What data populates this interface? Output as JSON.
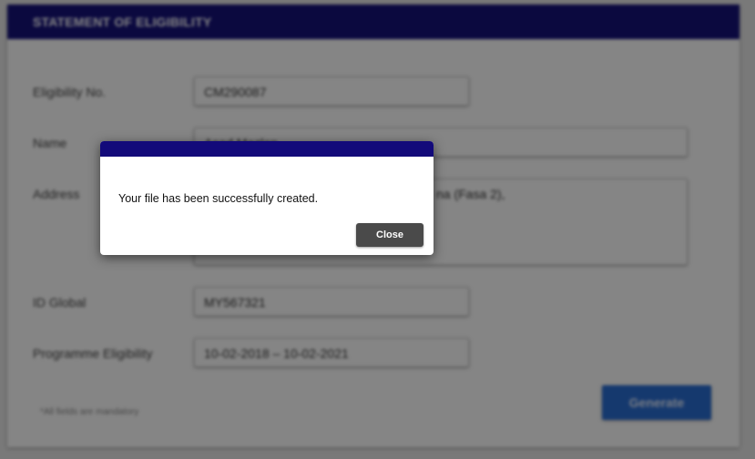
{
  "form": {
    "title": "STATEMENT OF ELIGIBILITY",
    "fields": {
      "eligibility_no": {
        "label": "Eligibility No.",
        "value": "CM290087"
      },
      "name": {
        "label": "Name",
        "value": "Asad Mazlan"
      },
      "address": {
        "label": "Address",
        "value": "na (Fasa 2),"
      },
      "id_global": {
        "label": "ID Global",
        "value": "MY567321"
      },
      "programme_eligibility": {
        "label": "Programme Eligibility",
        "value": "10-02-2018 – 10-02-2021"
      }
    },
    "note": "*All fields are mandatory",
    "generate_label": "Generate"
  },
  "modal": {
    "message": "Your file has been successfully created.",
    "close_label": "Close"
  },
  "colors": {
    "header": "#16127a",
    "modal_bar": "#130a7a",
    "generate_button": "#2a6ed4",
    "close_button": "#4a4a4a"
  }
}
